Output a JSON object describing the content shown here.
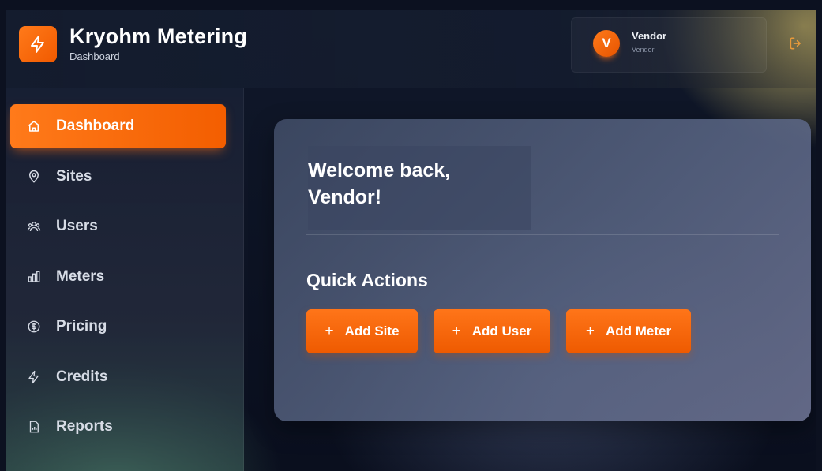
{
  "header": {
    "app_title": "Kryohm Metering",
    "subtitle": "Dashboard",
    "logo_icon": "lightning-icon",
    "user": {
      "avatar_letter": "V",
      "name": "Vendor",
      "role": "Vendor"
    },
    "logout_icon": "logout-icon"
  },
  "sidebar": {
    "items": [
      {
        "label": "Dashboard",
        "icon": "home-icon",
        "active": true
      },
      {
        "label": "Sites",
        "icon": "map-pin-icon"
      },
      {
        "label": "Users",
        "icon": "users-icon"
      },
      {
        "label": "Meters",
        "icon": "bar-chart-icon"
      },
      {
        "label": "Pricing",
        "icon": "dollar-circle-icon"
      },
      {
        "label": "Credits",
        "icon": "lightning-icon"
      },
      {
        "label": "Reports",
        "icon": "file-chart-icon"
      }
    ]
  },
  "main": {
    "welcome_line1": "Welcome back,",
    "welcome_line2": "Vendor!",
    "quick_actions_title": "Quick Actions",
    "actions": [
      {
        "icon": "+",
        "label": "Add Site"
      },
      {
        "icon": "+",
        "label": "Add User"
      },
      {
        "icon": "+",
        "label": "Add Meter"
      }
    ]
  },
  "colors": {
    "accent": "#f56a0a",
    "accent_light": "#ff7a1a"
  }
}
